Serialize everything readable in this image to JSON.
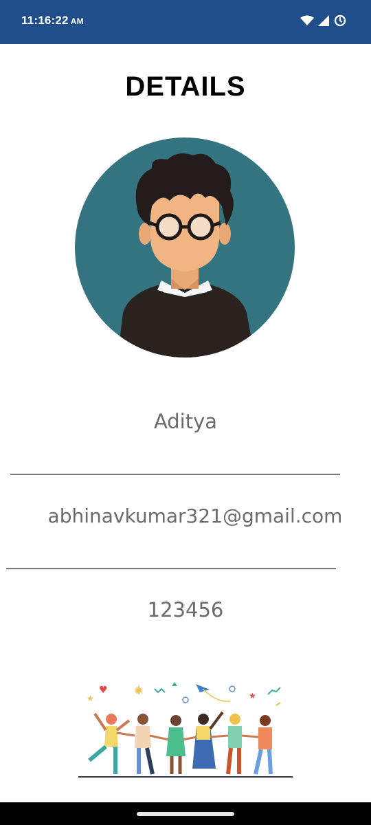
{
  "status_bar": {
    "time": "11:16:22",
    "ampm": "AM",
    "icons": [
      "wifi-icon",
      "cellular-signal-icon",
      "data-saver-icon"
    ]
  },
  "page": {
    "title": "DETAILS"
  },
  "profile": {
    "avatar": "avatar-illustration",
    "name": "Aditya",
    "email": "abhinavkumar321@gmail.com",
    "password": "123456"
  },
  "footer": {
    "illustration": "group-of-friends-illustration"
  },
  "nav": {
    "home_handle": "home-gesture-handle"
  },
  "colors": {
    "status_bar": "#1f4e8b",
    "avatar_bg": "#337480",
    "field_text": "#6b6b6b",
    "divider": "#7a7a7a"
  }
}
